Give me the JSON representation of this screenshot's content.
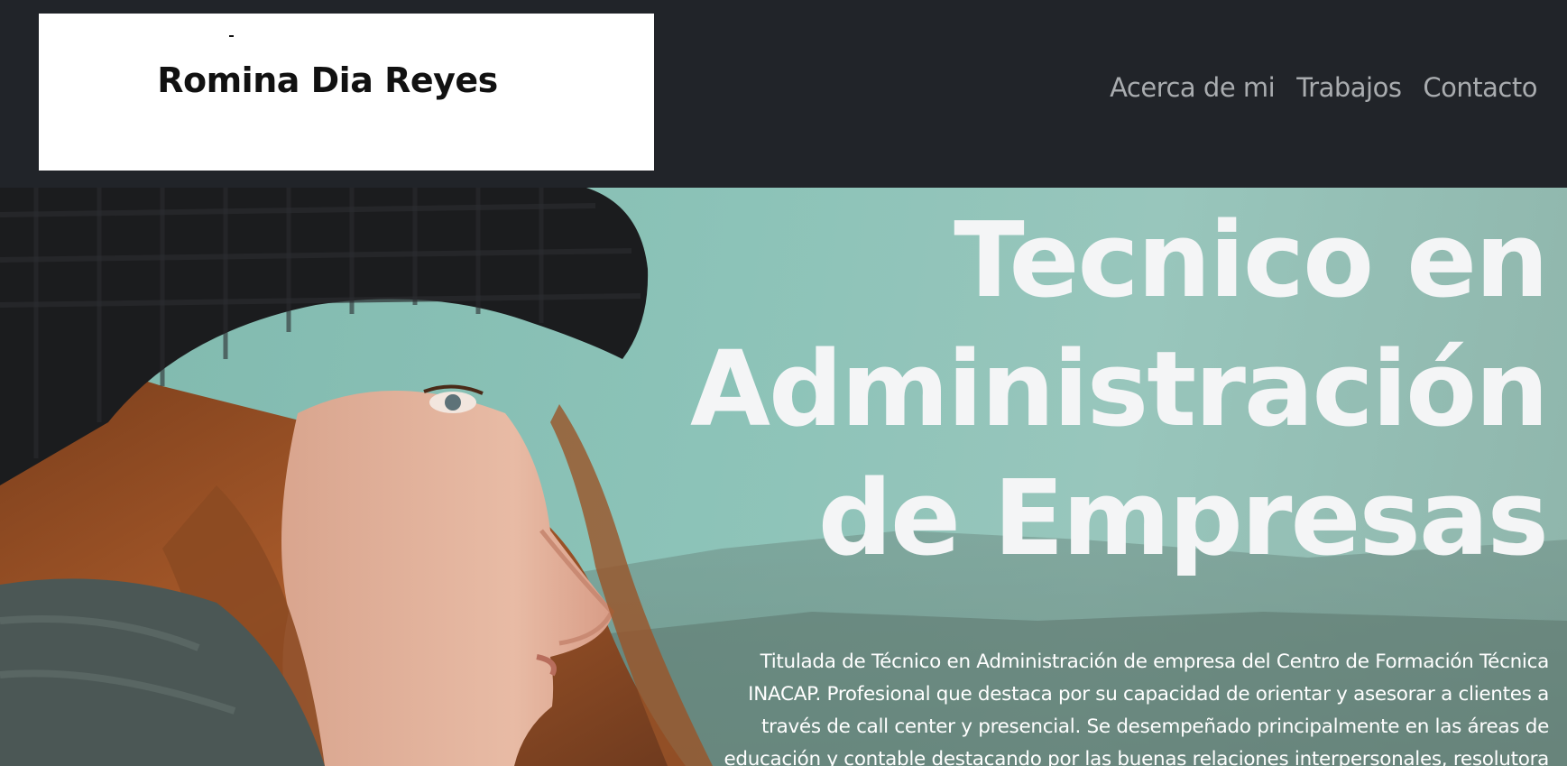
{
  "brand": {
    "logo_text": "Romina Dia Reyes"
  },
  "nav": {
    "items": [
      {
        "label": "Acerca de mi"
      },
      {
        "label": "Trabajos"
      },
      {
        "label": "Contacto"
      }
    ]
  },
  "hero": {
    "title": "Tecnico en Administración de Empresas",
    "description": "Titulada de Técnico en Administración de empresa del Centro de Formación Técnica INACAP. Profesional que destaca por su capacidad de orientar y asesorar a clientes a través de call center y presencial. Se desempeñado principalmente en las áreas de educación y contable destacando por las buenas relaciones interpersonales, resolutora"
  },
  "colors": {
    "navbar_bg": "#212429",
    "nav_link": "#a9acaf",
    "hero_bg": "#8cc3b8",
    "hero_text": "#f4f5f6"
  }
}
